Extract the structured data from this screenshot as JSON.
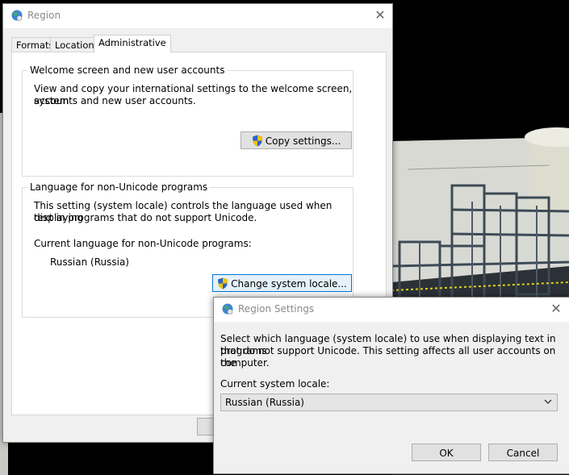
{
  "region": {
    "title": "Region",
    "tabs": [
      {
        "label": "Formats"
      },
      {
        "label": "Location"
      },
      {
        "label": "Administrative"
      }
    ],
    "welcome": {
      "label": "Welcome screen and new user accounts",
      "line1": "View and copy your international settings to the welcome screen, system",
      "line2": "accounts and new user accounts.",
      "button": "Copy settings..."
    },
    "nonunicode": {
      "label": "Language for non-Unicode programs",
      "line1": "This setting (system locale) controls the language used when displaying",
      "line2": "text in programs that do not support Unicode.",
      "current_label": "Current language for non-Unicode programs:",
      "current_value": "Russian (Russia)",
      "button": "Change system locale..."
    }
  },
  "settings": {
    "title": "Region Settings",
    "line1": "Select which language (system locale) to use when displaying text in programs",
    "line2": "that do not support Unicode. This setting affects all user accounts on the",
    "line3": "computer.",
    "locale_label": "Current system locale:",
    "locale_value": "Russian (Russia)",
    "ok": "OK",
    "cancel": "Cancel"
  },
  "colors": {
    "accent": "#0078d7",
    "window_bg": "#f0f0f0",
    "shield_blue": "#2a63c8",
    "shield_yellow": "#f2c200"
  },
  "icons": [
    "globe-icon",
    "close-icon",
    "shield-icon",
    "chevron-down-icon"
  ]
}
